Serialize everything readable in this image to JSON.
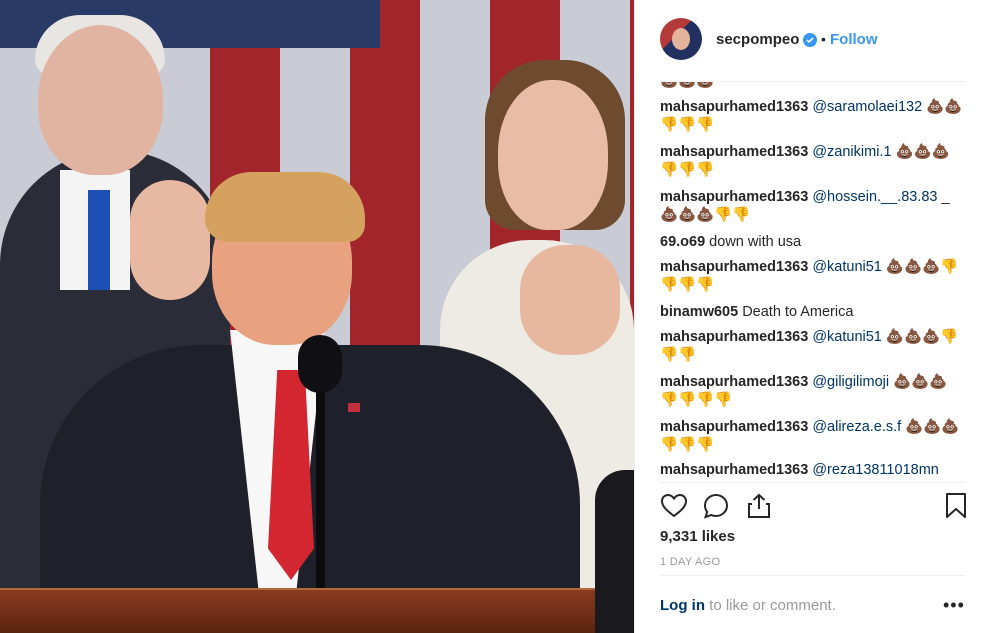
{
  "post": {
    "username": "secpompeo",
    "follow_label": "Follow",
    "separator": "•",
    "verified_icon": "verified-badge-icon",
    "likes": "9,331 likes",
    "time_ago": "1 DAY AGO",
    "login_link": "Log in",
    "login_rest": " to like or comment.",
    "more_label": "•••",
    "accent": "#3897f0",
    "link_color": "#003569"
  },
  "comments": [
    {
      "user": "",
      "mention": "",
      "text": "💩💩💩"
    },
    {
      "user": "mahsapurhamed1363",
      "mention": "@saramolaei132",
      "text": " 💩💩👎👎👎"
    },
    {
      "user": "mahsapurhamed1363",
      "mention": "@zanikimi.1",
      "text": " 💩💩💩👎👎👎"
    },
    {
      "user": "mahsapurhamed1363",
      "mention": "@hossein.__.83.83",
      "text": " _💩💩💩👎👎"
    },
    {
      "user": "69.o69",
      "mention": "",
      "text": " down with usa"
    },
    {
      "user": "mahsapurhamed1363",
      "mention": "@katuni51",
      "text": " 💩💩💩👎👎👎👎"
    },
    {
      "user": "binamw605",
      "mention": "",
      "text": " Death to America"
    },
    {
      "user": "mahsapurhamed1363",
      "mention": "@katuni51",
      "text": " 💩💩💩👎👎👎"
    },
    {
      "user": "mahsapurhamed1363",
      "mention": "@giligilimoji",
      "text": " 💩💩💩👎👎👎👎"
    },
    {
      "user": "mahsapurhamed1363",
      "mention": "@alireza.e.s.f",
      "text": " 💩💩💩👎👎👎"
    },
    {
      "user": "mahsapurhamed1363",
      "mention": "@reza13811018mn",
      "text": ""
    }
  ],
  "icons": {
    "like": "heart-icon",
    "comment": "comment-bubble-icon",
    "share": "share-icon",
    "save": "bookmark-icon"
  }
}
